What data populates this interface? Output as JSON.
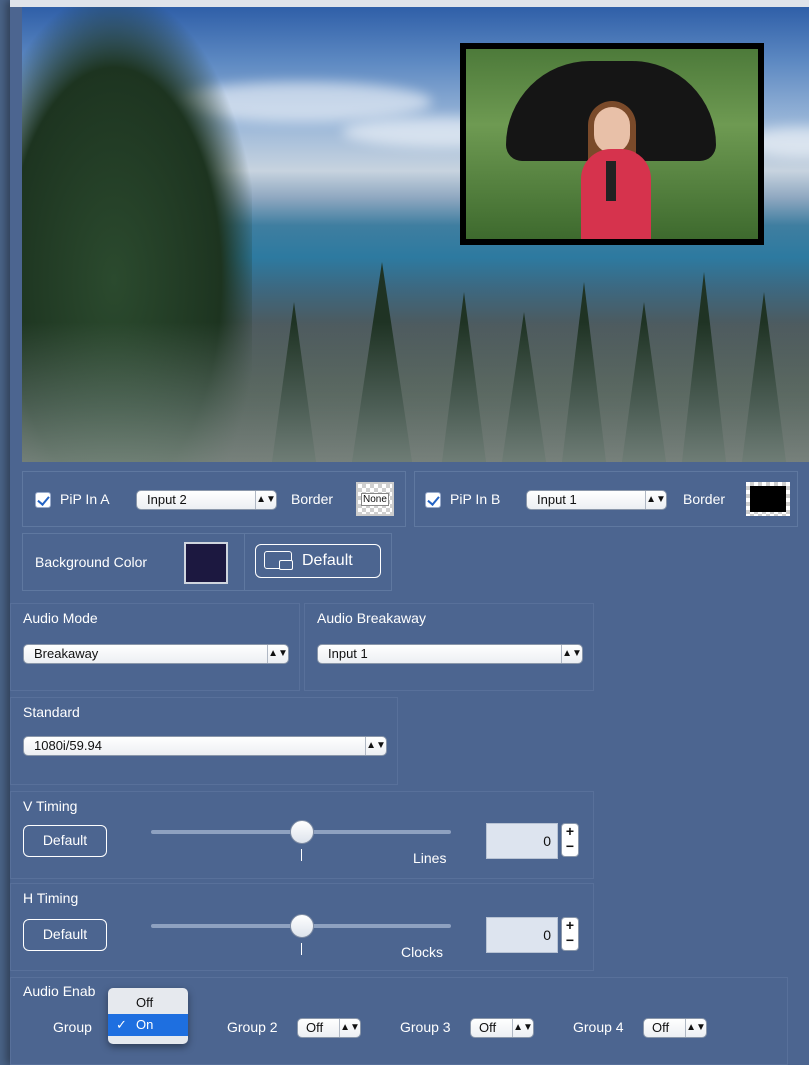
{
  "pip": {
    "a": {
      "checked": true,
      "label": "PiP In A",
      "input": "Input 2",
      "border_label": "Border",
      "border_value": "None"
    },
    "b": {
      "checked": true,
      "label": "PiP In B",
      "input": "Input 1",
      "border_label": "Border",
      "border_color": "#000000"
    }
  },
  "background": {
    "label": "Background Color",
    "color": "#1c1840",
    "default_label": "Default"
  },
  "audio_mode": {
    "label": "Audio Mode",
    "value": "Breakaway"
  },
  "audio_breakaway": {
    "label": "Audio Breakaway",
    "value": "Input 1"
  },
  "standard": {
    "label": "Standard",
    "value": "1080i/59.94"
  },
  "v_timing": {
    "label": "V Timing",
    "default_label": "Default",
    "unit": "Lines",
    "value": "0",
    "slider_fraction": 0.5
  },
  "h_timing": {
    "label": "H Timing",
    "default_label": "Default",
    "unit": "Clocks",
    "value": "0",
    "slider_fraction": 0.5
  },
  "audio_enable": {
    "label": "Audio Enab",
    "group1_label": "Group",
    "menu": {
      "options": [
        "Off",
        "On"
      ],
      "selected": "On"
    },
    "groups": [
      {
        "label": "Group 2",
        "value": "Off"
      },
      {
        "label": "Group 3",
        "value": "Off"
      },
      {
        "label": "Group 4",
        "value": "Off"
      }
    ]
  },
  "colors": {
    "panel": "#4c6590",
    "accent": "#1e6fe0"
  }
}
